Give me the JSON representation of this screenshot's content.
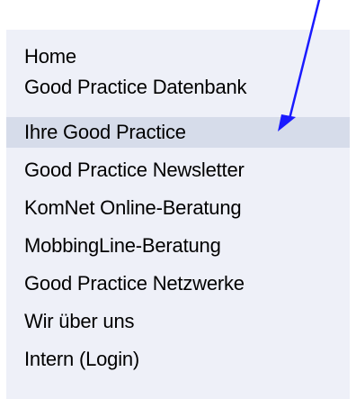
{
  "nav": {
    "items": [
      {
        "label": "Home"
      },
      {
        "label": "Good Practice Datenbank"
      },
      {
        "label": "Ihre Good Practice"
      },
      {
        "label": "Good Practice Newsletter"
      },
      {
        "label": "KomNet Online-Beratung"
      },
      {
        "label": "MobbingLine-Beratung"
      },
      {
        "label": "Good Practice Netzwerke"
      },
      {
        "label": "Wir über uns"
      },
      {
        "label": "Intern (Login)"
      }
    ],
    "active_index": 2,
    "colors": {
      "panel_background": "#eef0f8",
      "active_background": "#d6dcea",
      "text": "#000000"
    }
  },
  "annotation": {
    "icon": "arrow-icon",
    "color": "#1a1aff"
  }
}
